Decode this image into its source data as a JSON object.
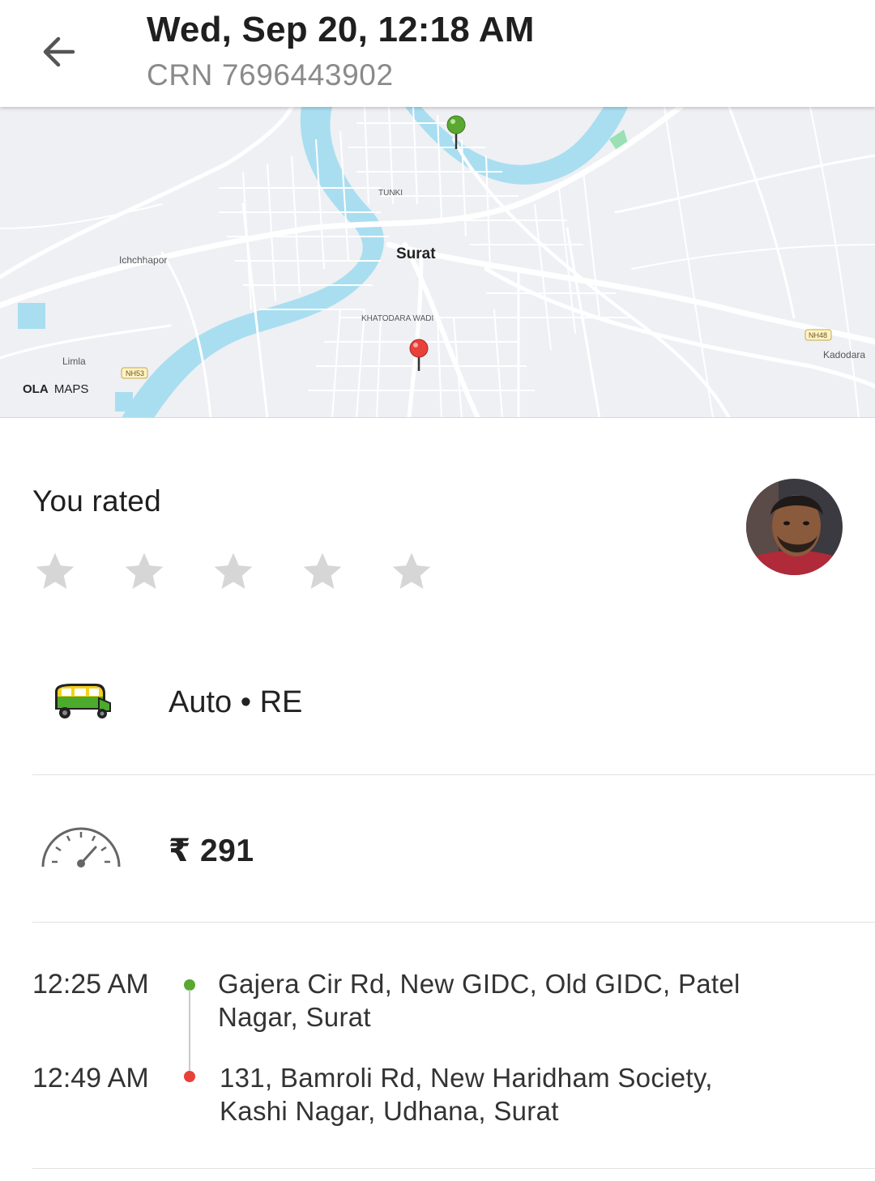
{
  "header": {
    "title": "Wed, Sep 20, 12:18 AM",
    "subtitle": "CRN 7696443902",
    "back_icon": "arrow-left-icon"
  },
  "map": {
    "brand_bold": "OLA",
    "brand_light": "MAPS",
    "labels": {
      "city": "Surat",
      "tunki": "TUNKI",
      "ichchhapor": "Ichchhapor",
      "khatodara": "KHATODARA WADI",
      "limla": "Limla",
      "kadodara": "Kadodara",
      "nh53": "NH53",
      "nh48": "NH48"
    },
    "colors": {
      "water": "#a9def0",
      "road": "#ffffff",
      "land": "#eef0f4",
      "pickup_pin": "#5aa832",
      "drop_pin": "#e8413a"
    }
  },
  "rating": {
    "title": "You rated",
    "stars_filled": 0,
    "stars_total": 5,
    "star_color": "#d6d6d6"
  },
  "vehicle": {
    "icon": "auto-rickshaw-icon",
    "label": "Auto • RE"
  },
  "fare": {
    "icon": "speedometer-icon",
    "amount": "₹ 291"
  },
  "trip": {
    "pickup": {
      "time": "12:25 AM",
      "address": "Gajera Cir Rd, New GIDC, Old GIDC, Patel Nagar, Surat",
      "dot_color": "#5aa832"
    },
    "drop": {
      "time": "12:49 AM",
      "address": "131, Bamroli Rd, New Haridham Society, Kashi Nagar, Udhana, Surat",
      "dot_color": "#e8413a"
    }
  }
}
